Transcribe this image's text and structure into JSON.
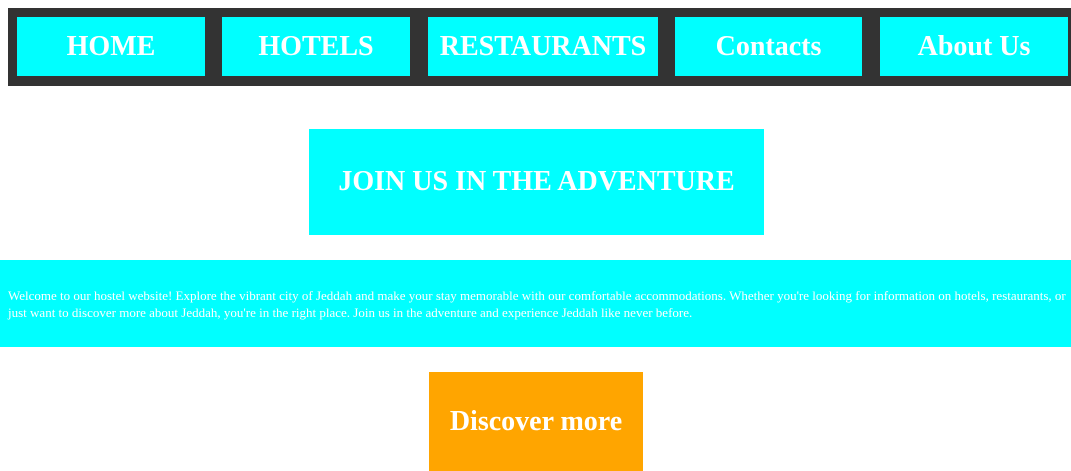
{
  "nav": {
    "items": [
      {
        "label": "HOME"
      },
      {
        "label": "HOTELS"
      },
      {
        "label": "RESTAURANTS"
      },
      {
        "label": "Contacts"
      },
      {
        "label": "About Us"
      }
    ]
  },
  "hero": {
    "title": "JOIN US IN THE ADVENTURE"
  },
  "intro": {
    "text": "Welcome to our hostel website! Explore the vibrant city of Jeddah and make your stay memorable with our comfortable accommodations. Whether you're looking for information on hotels, restaurants, or just want to discover more about Jeddah, you're in the right place. Join us in the adventure and experience Jeddah like never before."
  },
  "cta": {
    "label": "Discover more"
  },
  "colors": {
    "nav_bg": "#333333",
    "accent": "#00ffff",
    "cta": "#ffa500",
    "text": "#ffffff"
  }
}
